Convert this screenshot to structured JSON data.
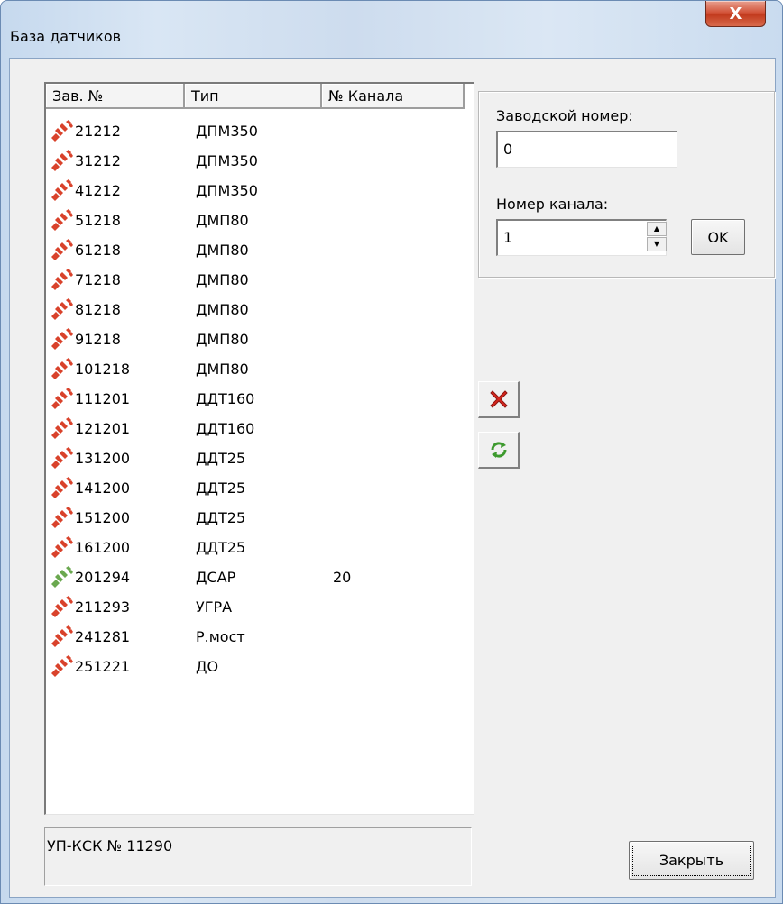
{
  "window": {
    "title": "База датчиков",
    "close_glyph": "X"
  },
  "list": {
    "columns": [
      "Зав. №",
      "Тип",
      "№ Канала"
    ],
    "rows": [
      {
        "serial": "21212",
        "type": "ДПМ350",
        "channel": "",
        "status": "disconnected"
      },
      {
        "serial": "31212",
        "type": "ДПМ350",
        "channel": "",
        "status": "disconnected"
      },
      {
        "serial": "41212",
        "type": "ДПМ350",
        "channel": "",
        "status": "disconnected"
      },
      {
        "serial": "51218",
        "type": "ДМП80",
        "channel": "",
        "status": "disconnected"
      },
      {
        "serial": "61218",
        "type": "ДМП80",
        "channel": "",
        "status": "disconnected"
      },
      {
        "serial": "71218",
        "type": "ДМП80",
        "channel": "",
        "status": "disconnected"
      },
      {
        "serial": "81218",
        "type": "ДМП80",
        "channel": "",
        "status": "disconnected"
      },
      {
        "serial": "91218",
        "type": "ДМП80",
        "channel": "",
        "status": "disconnected"
      },
      {
        "serial": "101218",
        "type": "ДМП80",
        "channel": "",
        "status": "disconnected"
      },
      {
        "serial": "111201",
        "type": "ДДТ160",
        "channel": "",
        "status": "disconnected"
      },
      {
        "serial": "121201",
        "type": "ДДТ160",
        "channel": "",
        "status": "disconnected"
      },
      {
        "serial": "131200",
        "type": "ДДТ25",
        "channel": "",
        "status": "disconnected"
      },
      {
        "serial": "141200",
        "type": "ДДТ25",
        "channel": "",
        "status": "disconnected"
      },
      {
        "serial": "151200",
        "type": "ДДТ25",
        "channel": "",
        "status": "disconnected"
      },
      {
        "serial": "161200",
        "type": "ДДТ25",
        "channel": "",
        "status": "disconnected"
      },
      {
        "serial": "201294",
        "type": "ДСАР",
        "channel": "20",
        "status": "connected"
      },
      {
        "serial": "211293",
        "type": "УГРА",
        "channel": "",
        "status": "disconnected"
      },
      {
        "serial": "241281",
        "type": "Р.мост",
        "channel": "",
        "status": "disconnected"
      },
      {
        "serial": "251221",
        "type": "ДО",
        "channel": "",
        "status": "disconnected"
      }
    ],
    "status_colors": {
      "disconnected": "#d9422b",
      "connected": "#6aa84f"
    },
    "icon_name": "plug-icon"
  },
  "status_bar": {
    "text": "УП-КСК № 11290"
  },
  "form": {
    "serial_label": "Заводской номер:",
    "serial_value": "0",
    "channel_label": "Номер канала:",
    "channel_value": "1",
    "ok_label": "OK"
  },
  "actions": {
    "delete_icon": "delete-x-icon",
    "refresh_icon": "refresh-icon",
    "close_label": "Закрыть"
  }
}
